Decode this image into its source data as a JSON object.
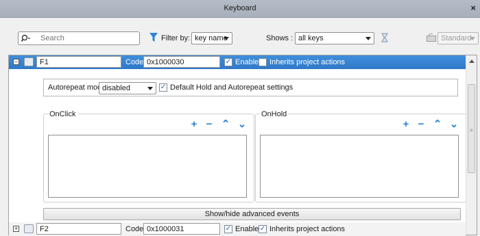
{
  "window": {
    "title": "Keyboard",
    "close": "×"
  },
  "toolbar": {
    "search_placeholder": "Search",
    "filter_label": "Filter by:",
    "filter_value": "key name",
    "shows_label": "Shows :",
    "shows_value": "all keys",
    "standard_value": "Standard"
  },
  "rows": [
    {
      "expander": "−",
      "name": "F1",
      "code_label": "Code",
      "code": "0x1000030",
      "enable_label": "Enable",
      "enable_checked": "✓",
      "inherit_label": "Inherits project actions",
      "inherit_checked": ""
    },
    {
      "expander": "+",
      "name": "F2",
      "code_label": "Code",
      "code": "0x1000031",
      "enable_label": "Enable",
      "enable_checked": "✓",
      "inherit_label": "Inherits project actions",
      "inherit_checked": "✓"
    }
  ],
  "detail": {
    "autorepeat_label": "Autorepeat mode",
    "autorepeat_value": "disabled",
    "default_hold_label": "Default Hold and Autorepeat settings",
    "default_hold_checked": "✓",
    "onclick_title": "OnClick",
    "onhold_title": "OnHold",
    "tool_add": "+",
    "tool_remove": "−",
    "tool_up": "⌃",
    "tool_down": "⌄",
    "advanced_button": "Show/hide advanced events"
  },
  "colors": {
    "selection": "#3a87d6",
    "accent_icon": "#2b82d9",
    "titlebar": "#adb6c1"
  }
}
